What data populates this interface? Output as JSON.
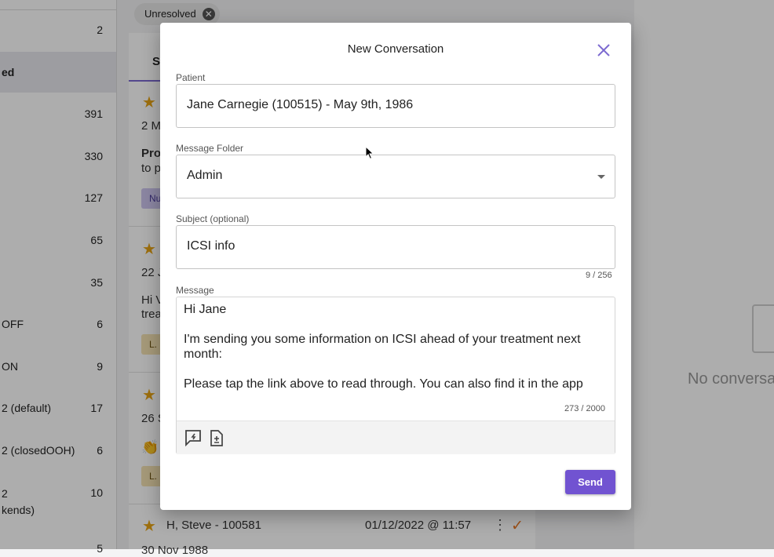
{
  "sidebar": {
    "items": [
      {
        "label": "",
        "count": "2"
      },
      {
        "label": "ed",
        "count": ""
      },
      {
        "label": "",
        "count": "391"
      },
      {
        "label": "",
        "count": "330"
      },
      {
        "label": "",
        "count": "127"
      },
      {
        "label": "",
        "count": "65"
      },
      {
        "label": "",
        "count": "35"
      },
      {
        "label": "OFF",
        "count": "6"
      },
      {
        "label": "ON",
        "count": "9"
      },
      {
        "label": "2 (default)",
        "count": "17"
      },
      {
        "label": "2 (closedOOH)",
        "count": "6"
      },
      {
        "label": "2\nkends)",
        "count": "10"
      },
      {
        "label": "",
        "count": "5"
      }
    ]
  },
  "list": {
    "filter_chip": "Unresolved",
    "tab_label": "S",
    "items": [
      {
        "date_line": "2 M",
        "preview_bold": "Pro",
        "preview": "to p",
        "tag": "Nu"
      },
      {
        "date_line": "22 J",
        "preview": "Hi V",
        "preview2": "trea",
        "tag": "L."
      },
      {
        "date_line": "26 S",
        "emoji": "👏",
        "tag": "L."
      },
      {
        "name": "H, Steve - 100581",
        "timestamp": "01/12/2022 @ 11:57",
        "date_line": "30 Nov 1988"
      }
    ]
  },
  "right_panel": {
    "empty_text": "No conversa"
  },
  "modal": {
    "title": "New Conversation",
    "patient": {
      "label": "Patient",
      "value": "Jane Carnegie (100515) - May 9th, 1986"
    },
    "folder": {
      "label": "Message Folder",
      "value": "Admin"
    },
    "subject": {
      "label": "Subject (optional)",
      "value": "ICSI info",
      "counter": "9 / 256"
    },
    "message": {
      "label": "Message",
      "text": "Hi Jane\n\nI'm sending you some information on ICSI ahead of your treatment next month:\n\nPlease tap the link above to read through. You can also find it in the app",
      "counter": "273 / 2000"
    },
    "send_label": "Send"
  },
  "icons": [
    "close-icon",
    "quick-reply-icon",
    "attach-document-icon",
    "star-icon",
    "more-vert-icon",
    "check-icon",
    "envelope-icon"
  ],
  "colors": {
    "accent": "#7153d1",
    "star": "#e7a416",
    "check": "#e87722",
    "close": "#7c6ad0"
  }
}
